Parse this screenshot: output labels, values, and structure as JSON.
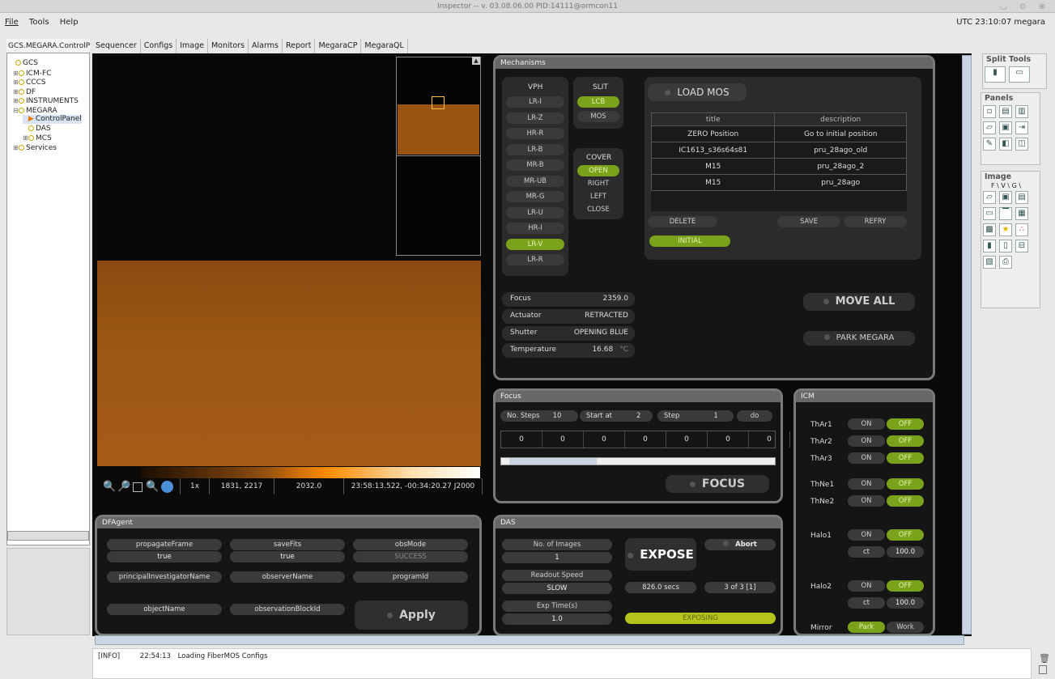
{
  "window": {
    "title": "Inspector  -- v. 03.08.06.00 PID:14111@ormcon11",
    "controls": "◡ ⊙ ⊗"
  },
  "menu": {
    "file": "File",
    "tools": "Tools",
    "help": "Help"
  },
  "clock": "UTC 23:10:07   megara",
  "left": {
    "tab": "GCS.MEGARA.ControlP",
    "tree": [
      {
        "label": "GCS",
        "exp": ""
      },
      {
        "label": "ICM-FC",
        "exp": "⊞"
      },
      {
        "label": "CCCS",
        "exp": "⊞"
      },
      {
        "label": "DF",
        "exp": "⊞"
      },
      {
        "label": "INSTRUMENTS",
        "exp": "⊞"
      },
      {
        "label": "MEGARA",
        "exp": "⊟"
      },
      {
        "label": "ControlPanel",
        "exp": ""
      },
      {
        "label": "DAS",
        "exp": ""
      },
      {
        "label": "MCS",
        "exp": "⊞"
      },
      {
        "label": "Services",
        "exp": "⊞"
      }
    ]
  },
  "tabs": [
    "Sequencer",
    "Configs",
    "Image",
    "Monitors",
    "Alarms",
    "Report",
    "MegaraCP",
    "MegaraQL"
  ],
  "image": {
    "zoom": "1x",
    "coords": "1831, 2217",
    "value": "2032.0",
    "radec": "23:58:13.522, -00:34:20.27 J2000"
  },
  "mechanisms": {
    "title": "Mechanisms",
    "vph_title": "VPH",
    "vph": [
      "LR-I",
      "LR-Z",
      "HR-R",
      "LR-B",
      "MR-B",
      "MR-UB",
      "MR-G",
      "LR-U",
      "HR-I",
      "LR-V",
      "LR-R"
    ],
    "vph_selected": "LR-V",
    "slit_title": "SLIT",
    "slit": [
      "LCB",
      "MOS"
    ],
    "slit_selected": "LCB",
    "cover_title": "COVER",
    "cover": [
      "OPEN",
      "RIGHT",
      "LEFT",
      "CLOSE"
    ],
    "cover_selected": "OPEN",
    "load_mos": "LOAD MOS",
    "mos_headers": [
      "title",
      "description"
    ],
    "mos_rows": [
      [
        "ZERO Position",
        "Go to initial position"
      ],
      [
        "IC1613_s36s64s81",
        "pru_28ago_old"
      ],
      [
        "M15",
        "pru_28ago_2"
      ],
      [
        "M15",
        "pru_28ago"
      ]
    ],
    "delete": "DELETE",
    "save": "SAVE",
    "refry": "REFRY",
    "initial": "INITIAL",
    "status": [
      {
        "label": "Focus",
        "value": "2359.0",
        "unit": ""
      },
      {
        "label": "Actuator",
        "value": "RETRACTED",
        "unit": ""
      },
      {
        "label": "Shutter",
        "value": "OPENING BLUE",
        "unit": ""
      },
      {
        "label": "Temperature",
        "value": "16.68",
        "unit": "°C"
      }
    ],
    "move_all": "MOVE ALL",
    "park": "PARK MEGARA"
  },
  "focus": {
    "title": "Focus",
    "nsteps_label": "No. Steps",
    "nsteps": "10",
    "start_label": "Start at",
    "start": "2",
    "step_label": "Step",
    "step": "1",
    "do": "do",
    "values": [
      "0",
      "0",
      "0",
      "0",
      "0",
      "0",
      "0"
    ],
    "button": "FOCUS"
  },
  "icm": {
    "title": "ICM",
    "lamps": [
      "ThAr1",
      "ThAr2",
      "ThAr3",
      "ThNe1",
      "ThNe2",
      "Halo1",
      "Halo2"
    ],
    "on": "ON",
    "off": "OFF",
    "ct_label": "ct",
    "halo1_ct": "100.0",
    "halo2_ct": "100.0",
    "mirror": "Mirror",
    "park": "Park",
    "work": "Work"
  },
  "dfagent": {
    "title": "DFAgent",
    "fields": [
      {
        "label": "propagateFrame",
        "value": "true"
      },
      {
        "label": "saveFits",
        "value": "true"
      },
      {
        "label": "obsMode",
        "value": "SUCCESS"
      },
      {
        "label": "principalInvestigatorName",
        "value": ""
      },
      {
        "label": "observerName",
        "value": ""
      },
      {
        "label": "programId",
        "value": ""
      },
      {
        "label": "objectName",
        "value": ""
      },
      {
        "label": "observationBlockId",
        "value": ""
      }
    ],
    "apply": "Apply"
  },
  "das": {
    "title": "DAS",
    "nimg_label": "No. of Images",
    "nimg": "1",
    "readout_label": "Readout Speed",
    "readout": "SLOW",
    "exptime_label": "Exp Time(s)",
    "exptime": "1.0",
    "expose": "EXPOSE",
    "abort": "Abort",
    "secs": "826.0 secs",
    "count": "3 of 3 [1]",
    "state": "EXPOSING"
  },
  "split_tools": "Split Tools",
  "panels": "Panels",
  "image_tools": "Image",
  "image_tabs": "F \\ V \\ G \\",
  "log": {
    "level": "[INFO]",
    "time": "22:54:13",
    "msg": "Loading FiberMOS Configs"
  },
  "colors": {
    "green": "#7aa21a",
    "panel_border": "#7a7a7a",
    "expose_bar": "#b6c31c",
    "orange": "#9a5412"
  }
}
